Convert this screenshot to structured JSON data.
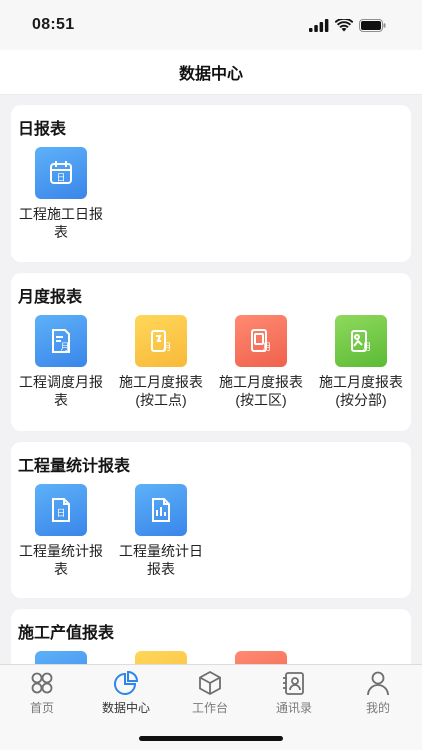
{
  "status": {
    "time": "08:51"
  },
  "header": {
    "title": "数据中心"
  },
  "sections": [
    {
      "title": "日报表",
      "items": [
        {
          "label": "工程施工日报表",
          "color": "#4a9df3",
          "icon": "calendar-day-icon"
        }
      ]
    },
    {
      "title": "月度报表",
      "items": [
        {
          "label": "工程调度月报表",
          "color": "#4a9df3",
          "icon": "month-report-icon"
        },
        {
          "label": "施工月度报表(按工点)",
          "color": "#fbc845",
          "icon": "month-doc-icon"
        },
        {
          "label": "施工月度报表(按工区)",
          "color": "#f4735c",
          "icon": "month-list-icon"
        },
        {
          "label": "施工月度报表(按分部)",
          "color": "#74c946",
          "icon": "month-image-icon"
        }
      ]
    },
    {
      "title": "工程量统计报表",
      "items": [
        {
          "label": "工程量统计报表",
          "color": "#4a9df3",
          "icon": "stat-day-icon"
        },
        {
          "label": "工程量统计日报表",
          "color": "#4a9df3",
          "icon": "stat-chart-icon"
        }
      ]
    },
    {
      "title": "施工产值报表",
      "items": []
    }
  ],
  "tabs": [
    {
      "label": "首页",
      "icon": "home-grid-icon",
      "active": false
    },
    {
      "label": "数据中心",
      "icon": "pie-chart-icon",
      "active": true
    },
    {
      "label": "工作台",
      "icon": "cube-icon",
      "active": false
    },
    {
      "label": "通讯录",
      "icon": "contacts-icon",
      "active": false
    },
    {
      "label": "我的",
      "icon": "user-icon",
      "active": false
    }
  ]
}
